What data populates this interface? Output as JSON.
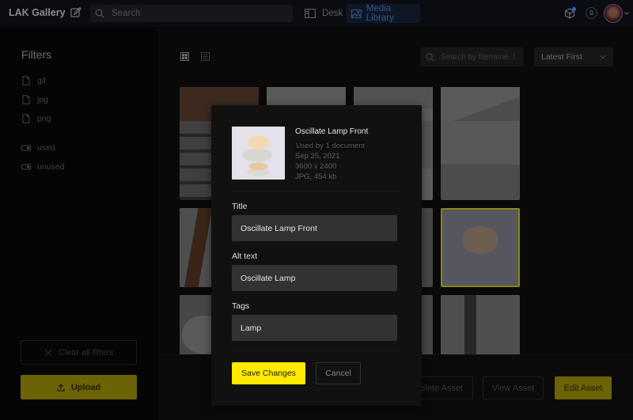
{
  "topbar": {
    "brand": "LAK Gallery",
    "search_placeholder": "Search",
    "nav": [
      {
        "label": "Desk",
        "icon": "desk-icon",
        "active": false
      },
      {
        "label": "Media Library",
        "icon": "image-icon",
        "active": true
      }
    ],
    "notification_count": "0",
    "accent_color": "#355489"
  },
  "sidebar": {
    "title": "Filters",
    "file_types": [
      {
        "label": "gif",
        "icon": "file-icon"
      },
      {
        "label": "jpg",
        "icon": "file-icon"
      },
      {
        "label": "png",
        "icon": "file-icon"
      }
    ],
    "usage": [
      {
        "label": "used",
        "icon": "toggle-icon"
      },
      {
        "label": "unused",
        "icon": "toggle-icon"
      }
    ],
    "clear_label": "Clear all filters",
    "upload_label": "Upload"
  },
  "toolbar": {
    "search_placeholder": "Search by filename, t",
    "sort_value": "Latest First"
  },
  "grid": {
    "selected_index": 11,
    "tiles": [
      {
        "subject": "wood-table"
      },
      {
        "subject": "wooden-chair"
      },
      {
        "subject": "room-interior"
      },
      {
        "subject": "black-chair"
      },
      {
        "subject": "shelf"
      },
      {
        "subject": "shelf"
      },
      {
        "subject": "room-interior"
      },
      {
        "subject": "bench-room"
      },
      {
        "subject": "ladder"
      },
      {
        "subject": "image"
      },
      {
        "subject": "image"
      },
      {
        "subject": "lamp"
      },
      {
        "subject": "lamp-side"
      },
      {
        "subject": "image"
      },
      {
        "subject": "image"
      },
      {
        "subject": "dark-object"
      }
    ]
  },
  "actions": {
    "delete_label": "Delete Asset",
    "view_label": "View Asset",
    "edit_label": "Edit Asset"
  },
  "modal": {
    "asset_name": "Oscillate Lamp Front",
    "usage": "Used by 1 document",
    "date": "Sep 25, 2021",
    "dimensions": "3600 x 2400",
    "format_size": "JPG, 454 kb",
    "fields": {
      "title_label": "Title",
      "title_value": "Oscillate Lamp Front",
      "alt_label": "Alt text",
      "alt_value": "Oscillate Lamp",
      "tags_label": "Tags",
      "tags_value": "Lamp"
    },
    "save_label": "Save Changes",
    "cancel_label": "Cancel",
    "save_color": "#ffea00"
  }
}
